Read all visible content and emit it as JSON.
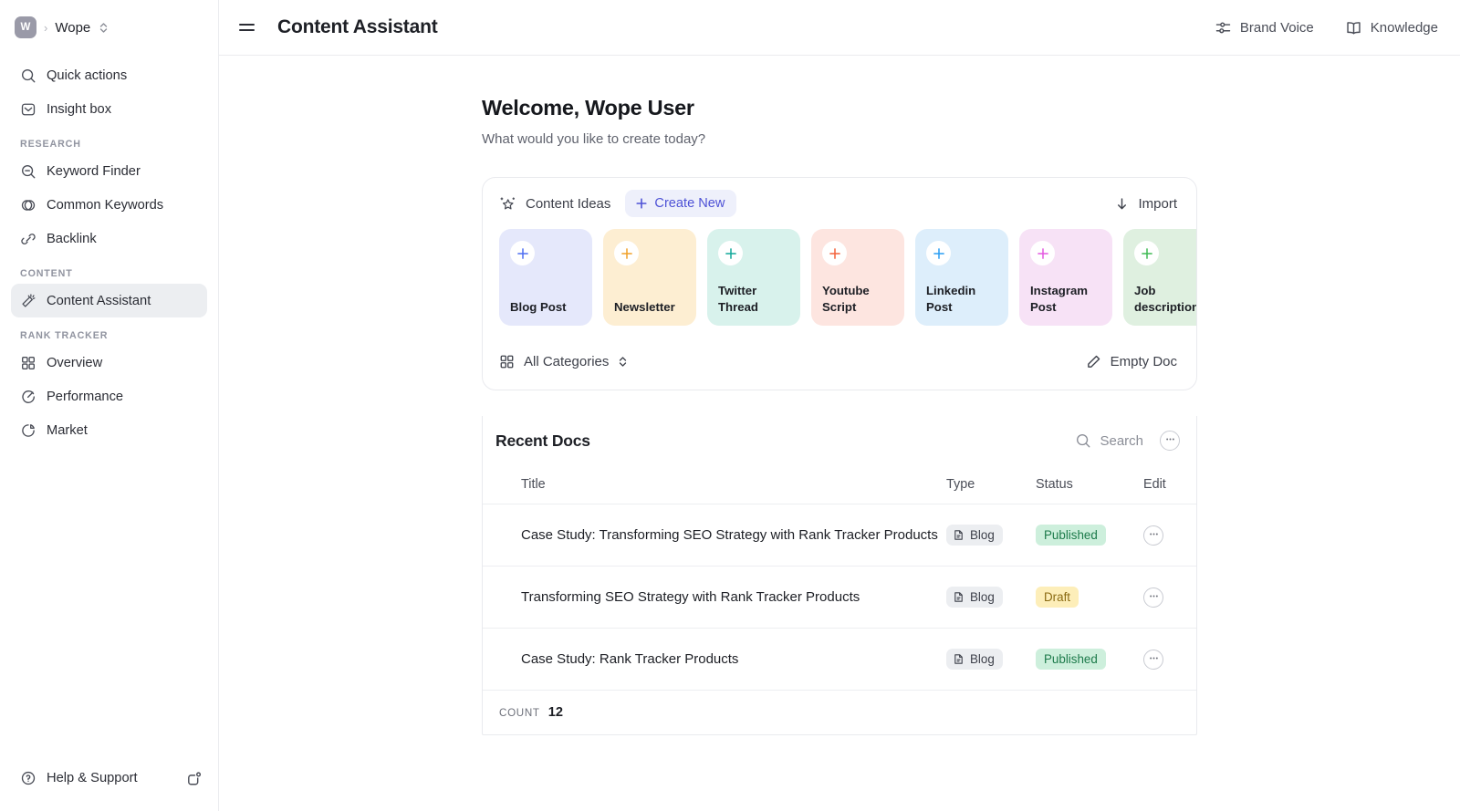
{
  "sidebar": {
    "workspace": {
      "avatar_initial": "W",
      "separator": "›",
      "name": "Wope"
    },
    "top_items": [
      {
        "label": "Quick actions",
        "icon": "search-icon"
      },
      {
        "label": "Insight box",
        "icon": "inbox-icon"
      }
    ],
    "sections": [
      {
        "title": "RESEARCH",
        "items": [
          {
            "label": "Keyword Finder",
            "icon": "keyword-search-icon"
          },
          {
            "label": "Common Keywords",
            "icon": "venn-circles-icon"
          },
          {
            "label": "Backlink",
            "icon": "link-icon"
          }
        ]
      },
      {
        "title": "CONTENT",
        "items": [
          {
            "label": "Content Assistant",
            "icon": "magic-wand-icon",
            "active": true
          }
        ]
      },
      {
        "title": "RANK TRACKER",
        "items": [
          {
            "label": "Overview",
            "icon": "grid-icon"
          },
          {
            "label": "Performance",
            "icon": "gauge-icon"
          },
          {
            "label": "Market",
            "icon": "pie-chart-icon"
          }
        ]
      }
    ],
    "help": {
      "label": "Help & Support",
      "icon": "question-circle-icon"
    },
    "notifications": {
      "icon": "notification-dot-icon"
    }
  },
  "topbar": {
    "menu_icon": "hamburger-icon",
    "title": "Content Assistant",
    "actions": [
      {
        "label": "Brand Voice",
        "icon": "sliders-icon"
      },
      {
        "label": "Knowledge",
        "icon": "book-open-icon"
      }
    ]
  },
  "welcome": {
    "title": "Welcome, Wope User",
    "subtitle": "What would you like to create today?"
  },
  "ideas": {
    "label": "Content Ideas",
    "label_icon": "sparkle-star-icon",
    "create_new": "Create New",
    "create_new_icon": "plus-icon",
    "import": "Import",
    "import_icon": "download-arrow-icon",
    "all_categories": "All Categories",
    "all_categories_icon": "grid-squares-icon",
    "empty_doc": "Empty Doc",
    "empty_doc_icon": "pencil-icon",
    "accent_color": "#4e52d6",
    "tiles": [
      {
        "label": "Blog Post",
        "bg": "#e5e8fb",
        "plus_color": "#4e6ef2"
      },
      {
        "label": "Newsletter",
        "bg": "#fdeed2",
        "plus_color": "#f0a028"
      },
      {
        "label": "Twitter\nThread",
        "bg": "#d8f2ec",
        "plus_color": "#12a89a"
      },
      {
        "label": "Youtube\nScript",
        "bg": "#fde5e0",
        "plus_color": "#f4623c"
      },
      {
        "label": "Linkedin\nPost",
        "bg": "#ddeefb",
        "plus_color": "#2a9df4"
      },
      {
        "label": "Instagram\nPost",
        "bg": "#f7e2f6",
        "plus_color": "#e458e0"
      },
      {
        "label": "Job\ndescription",
        "bg": "#dff0e0",
        "plus_color": "#3fba54"
      }
    ]
  },
  "recent": {
    "title": "Recent Docs",
    "search_placeholder": "Search",
    "search_icon": "search-icon",
    "more_icon": "ellipsis-icon",
    "columns": [
      "Title",
      "Type",
      "Status",
      "Edit"
    ],
    "rows": [
      {
        "title": "Case Study: Transforming SEO Strategy with Rank Tracker Products",
        "type": "Blog",
        "type_icon": "document-icon",
        "status": "Published",
        "status_kind": "published",
        "edit_icon": "ellipsis-icon"
      },
      {
        "title": "Transforming SEO Strategy with Rank Tracker Products",
        "type": "Blog",
        "type_icon": "document-icon",
        "status": "Draft",
        "status_kind": "draft",
        "edit_icon": "ellipsis-icon"
      },
      {
        "title": "Case Study: Rank Tracker Products",
        "type": "Blog",
        "type_icon": "document-icon",
        "status": "Published",
        "status_kind": "published",
        "edit_icon": "ellipsis-icon"
      }
    ],
    "count_label": "COUNT",
    "count_value": "12"
  },
  "colors": {
    "accent": "#4e52d6",
    "published_bg": "#cdefdc",
    "published_fg": "#1c7a4a",
    "draft_bg": "#fdeeb9",
    "draft_fg": "#8a6a12",
    "border": "#e9eaee"
  }
}
